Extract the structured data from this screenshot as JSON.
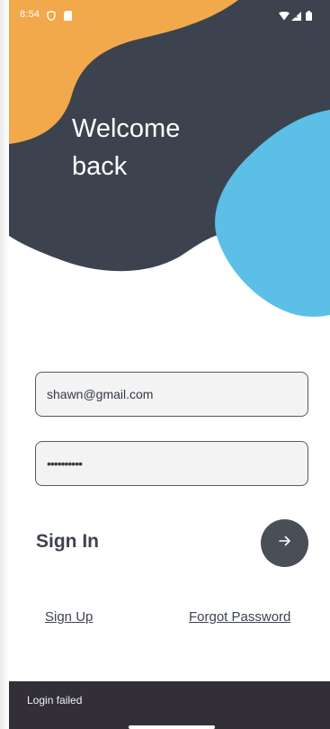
{
  "colors": {
    "orange_blob": "#f2a94b",
    "dark_blob": "#3d434e",
    "blue_blob": "#5bbfe6",
    "snackbar_bg": "#322f37",
    "button_bg": "#4a4e57"
  },
  "status_bar": {
    "time": "8:54",
    "left_icons": [
      "shield-icon",
      "sd-card-icon"
    ],
    "right_icons": [
      "wifi-icon",
      "signal-icon",
      "battery-icon"
    ]
  },
  "header": {
    "title": "Welcome\nback"
  },
  "form": {
    "email_value": "shawn@gmail.com",
    "password_value": "••••••••••",
    "sign_in_label": "Sign In",
    "submit_icon": "arrow-right-icon"
  },
  "links": {
    "sign_up": "Sign Up",
    "forgot_password": "Forgot Password"
  },
  "snackbar": {
    "message": "Login failed"
  }
}
